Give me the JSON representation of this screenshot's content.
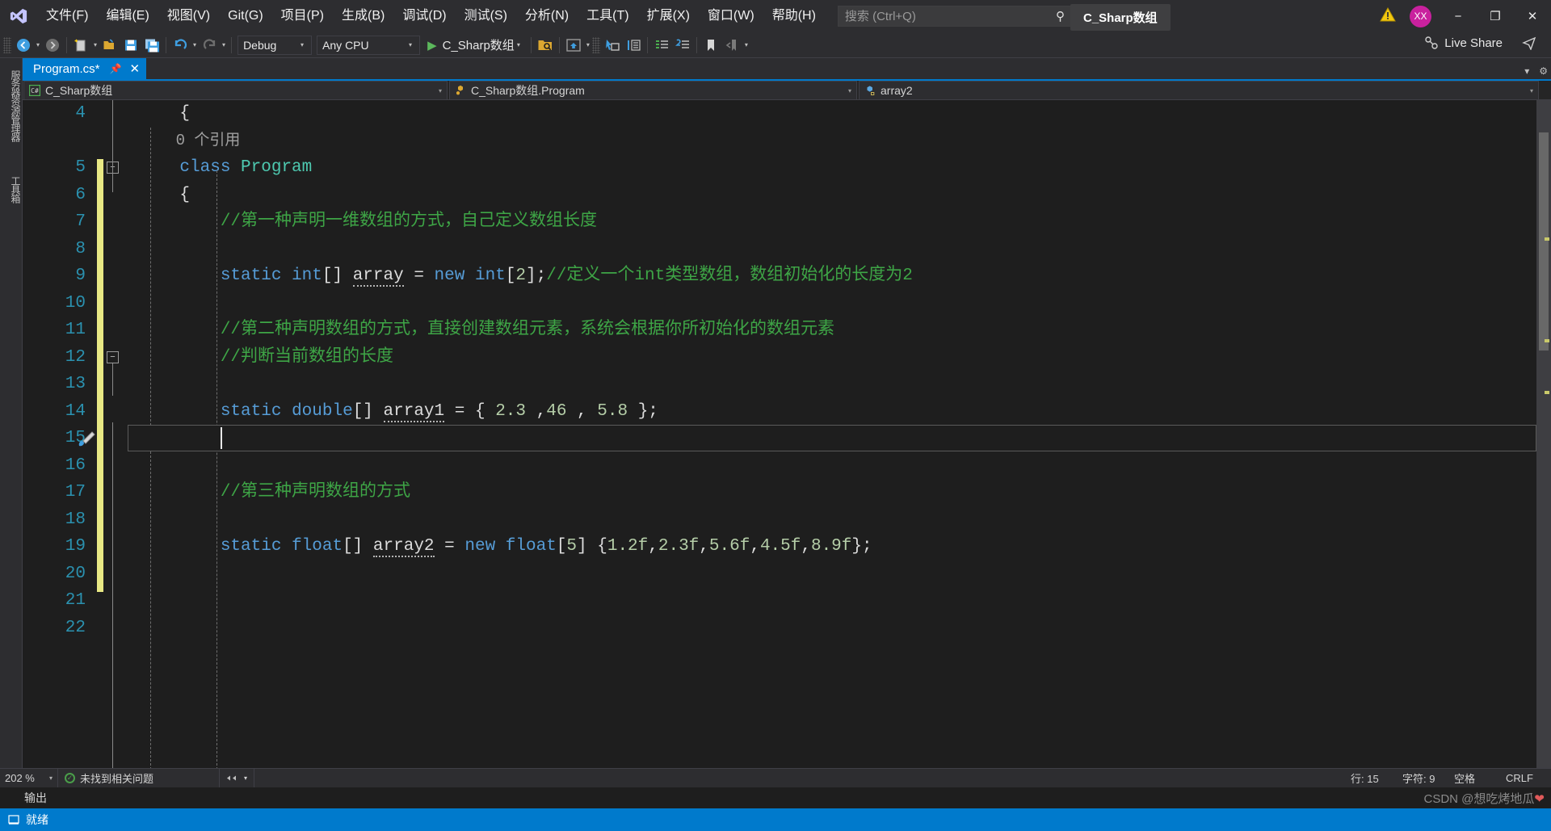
{
  "app": {
    "window_title": "C_Sharp数组",
    "logo_icon": "visual-studio-logo",
    "avatar_initials": "XX"
  },
  "menu": {
    "items": [
      {
        "label": "文件(F)",
        "accel": "F"
      },
      {
        "label": "编辑(E)",
        "accel": "E"
      },
      {
        "label": "视图(V)",
        "accel": "V"
      },
      {
        "label": "Git(G)",
        "accel": "G"
      },
      {
        "label": "项目(P)",
        "accel": "P"
      },
      {
        "label": "生成(B)",
        "accel": "B"
      },
      {
        "label": "调试(D)",
        "accel": "D"
      },
      {
        "label": "测试(S)",
        "accel": "S"
      },
      {
        "label": "分析(N)",
        "accel": "N"
      },
      {
        "label": "工具(T)",
        "accel": "T"
      },
      {
        "label": "扩展(X)",
        "accel": "X"
      },
      {
        "label": "窗口(W)",
        "accel": "W"
      },
      {
        "label": "帮助(H)",
        "accel": "H"
      }
    ]
  },
  "search": {
    "placeholder": "搜索 (Ctrl+Q)",
    "value": "",
    "icon": "search-icon"
  },
  "window_controls": {
    "minimize": "−",
    "restore": "❐",
    "close": "✕",
    "warning_icon": "warning-triangle-icon"
  },
  "toolbar": {
    "back_icon": "navigate-back-icon",
    "forward_icon": "navigate-forward-icon",
    "new_item_icon": "new-file-icon",
    "open_icon": "open-folder-icon",
    "save_icon": "save-icon",
    "save_all_icon": "save-all-icon",
    "undo_icon": "undo-icon",
    "redo_icon": "redo-icon",
    "config_label": "Debug",
    "platform_label": "Any CPU",
    "run_label": "C_Sharp数组",
    "run_icon": "play-icon",
    "search_folder_icon": "search-in-folder-icon",
    "home_window_icon": "start-window-icon",
    "pointer_window_icon": "select-window-icon",
    "properties_icon": "properties-window-icon",
    "solution_explorer_icon": "solution-explorer-icon",
    "toolbox_icon": "toolbox-icon",
    "bookmark_icon": "bookmark-icon",
    "prev_bookmark_icon": "previous-bookmark-icon",
    "live_share_label": "Live Share",
    "live_share_icon": "live-share-icon",
    "feedback_icon": "send-feedback-icon"
  },
  "left_dock": {
    "tabs": [
      {
        "label": "服务器资源管理器"
      },
      {
        "label": "工具箱"
      }
    ]
  },
  "document_tab": {
    "label": "Program.cs*",
    "pin_icon": "pin-icon",
    "close_icon": "close-icon",
    "caret_icon": "chevron-down-icon",
    "settings_icon": "gear-icon"
  },
  "navbar": {
    "project": "C_Sharp数组",
    "project_icon": "csharp-project-icon",
    "type": "C_Sharp数组.Program",
    "type_icon": "class-icon",
    "member": "array2",
    "member_icon": "field-private-icon",
    "caret_icon": "chevron-down-icon",
    "split_icon": "split-view-icon"
  },
  "editor": {
    "first_visible_line": 4,
    "codelens": "0 个引用",
    "cursor_line_number": 15,
    "lines": [
      {
        "n": 4,
        "html": "<span class=\"idf\">    {</span>",
        "text": "    {"
      },
      {
        "n": null,
        "html": "<span class=\"ref-hint\">    0 个引用</span>",
        "text": "    0 个引用",
        "codelens": true
      },
      {
        "n": 5,
        "html": "    <span class=\"kw\">class</span> <span class=\"typ\">Program</span>",
        "text": "    class Program"
      },
      {
        "n": 6,
        "html": "<span class=\"idf\">    {</span>",
        "text": "    {"
      },
      {
        "n": 7,
        "html": "        <span class=\"cmt\">//第一种声明一维数组的方式，自己定义数组长度</span>",
        "text": "        //第一种声明一维数组的方式，自己定义数组长度"
      },
      {
        "n": 8,
        "html": "",
        "text": ""
      },
      {
        "n": 9,
        "html": "        <span class=\"kw\">static</span> <span class=\"kw\">int</span><span class=\"idf\">[]</span> <span class=\"sq idf\">array</span> <span class=\"idf\">=</span> <span class=\"kw\">new</span> <span class=\"kw\">int</span><span class=\"idf\">[</span><span class=\"num\">2</span><span class=\"idf\">];</span><span class=\"cmt\">//定义一个int类型数组，数组初始化的长度为2</span>",
        "text": "        static int[] array = new int[2];//定义一个int类型数组，数组初始化的长度为2"
      },
      {
        "n": 10,
        "html": "",
        "text": ""
      },
      {
        "n": 11,
        "html": "        <span class=\"cmt\">//第二种声明数组的方式，直接创建数组元素，系统会根据你所初始化的数组元素</span>",
        "text": "        //第二种声明数组的方式，直接创建数组元素，系统会根据你所初始化的数组元素"
      },
      {
        "n": 12,
        "html": "        <span class=\"cmt\">//判断当前数组的长度</span>",
        "text": "        //判断当前数组的长度"
      },
      {
        "n": 13,
        "html": "",
        "text": ""
      },
      {
        "n": 14,
        "html": "        <span class=\"kw\">static</span> <span class=\"kw\">double</span><span class=\"idf\">[]</span> <span class=\"sq idf\">array1</span> <span class=\"idf\">=</span> <span class=\"idf\">{</span> <span class=\"num\">2.3</span> <span class=\"idf\">,</span><span class=\"num\">46</span> <span class=\"idf\">,</span> <span class=\"num\">5.8</span> <span class=\"idf\">};</span>",
        "text": "        static double[] array1 = { 2.3 ,46 , 5.8 };"
      },
      {
        "n": 15,
        "html": "",
        "text": "",
        "current": true
      },
      {
        "n": 16,
        "html": "",
        "text": ""
      },
      {
        "n": 17,
        "html": "        <span class=\"cmt\">//第三种声明数组的方式</span>",
        "text": "        //第三种声明数组的方式"
      },
      {
        "n": 18,
        "html": "",
        "text": ""
      },
      {
        "n": 19,
        "html": "        <span class=\"kw\">static</span> <span class=\"kw\">float</span><span class=\"idf\">[]</span> <span class=\"sq idf\">array2</span> <span class=\"idf\">=</span> <span class=\"kw\">new</span> <span class=\"kw\">float</span><span class=\"idf\">[</span><span class=\"num\">5</span><span class=\"idf\">]</span> <span class=\"idf\">{</span><span class=\"num\">1.2f</span><span class=\"idf\">,</span><span class=\"num\">2.3f</span><span class=\"idf\">,</span><span class=\"num\">5.6f</span><span class=\"idf\">,</span><span class=\"num\">4.5f</span><span class=\"idf\">,</span><span class=\"num\">8.9f</span><span class=\"idf\">};</span>",
        "text": "        static float[] array2 = new float[5] {1.2f,2.3f,5.6f,4.5f,8.9f};"
      },
      {
        "n": 20,
        "html": "",
        "text": ""
      },
      {
        "n": 21,
        "html": "",
        "text": ""
      },
      {
        "n": 22,
        "html": "",
        "text": ""
      }
    ]
  },
  "editor_status": {
    "zoom": "202 %",
    "issues": "未找到相关问题",
    "ok_icon": "check-circle-icon",
    "nav_icon": "navigate-icon",
    "line_label": "行: 15",
    "col_label": "字符: 9",
    "space_label": "空格",
    "eol_label": "CRLF"
  },
  "output_pane": {
    "title": "输出"
  },
  "status_bar": {
    "ready": "就绪",
    "ready_icon": "ready-icon"
  },
  "watermark": {
    "text": "CSDN @想吃烤地瓜"
  },
  "colors": {
    "accent": "#007acc",
    "chrome": "#2d2d30",
    "editor_bg": "#1e1e1e",
    "keyword": "#569cd6",
    "type": "#4ec9b0",
    "comment": "#3ea546",
    "number": "#b5cea8",
    "linenumber": "#2b91af",
    "avatar": "#c9219e",
    "changebar_unsaved": "#e8e884"
  }
}
